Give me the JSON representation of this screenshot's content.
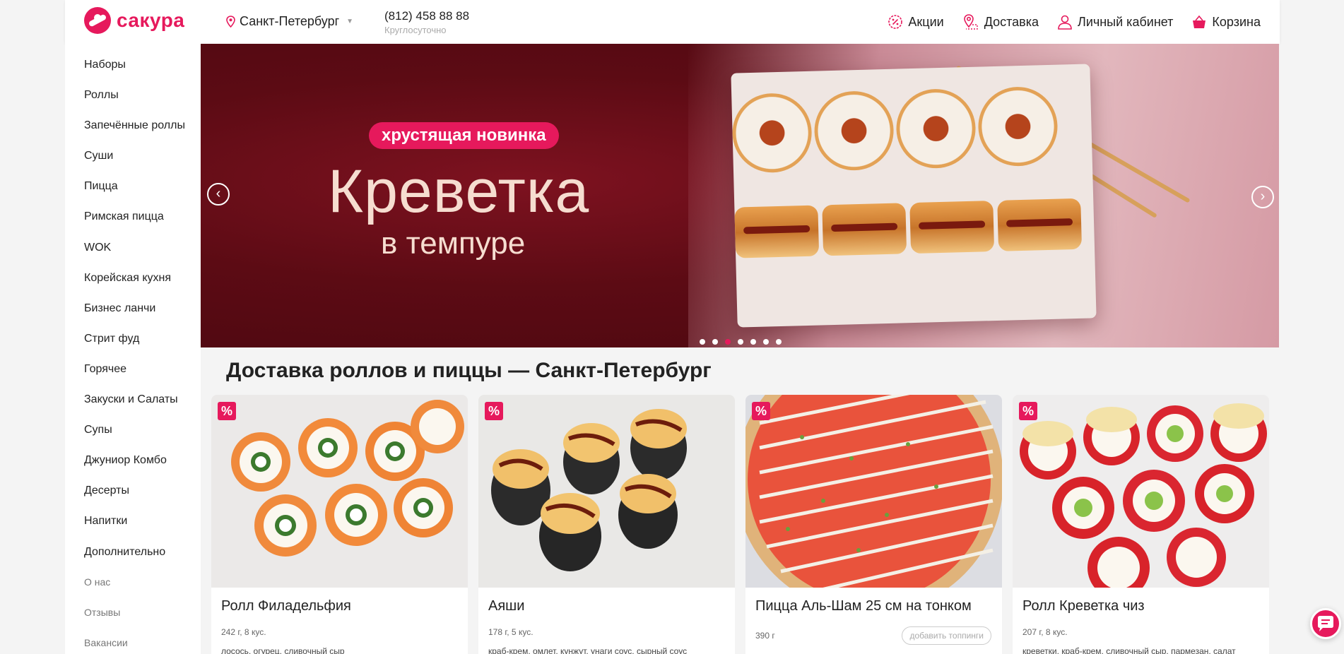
{
  "header": {
    "logo_text": "сакура",
    "city": "Санкт-Петербург",
    "phone": "(812) 458 88 88",
    "phone_hours": "Круглосуточно",
    "nav": [
      {
        "label": "Акции",
        "icon": "percent-badge-icon"
      },
      {
        "label": "Доставка",
        "icon": "map-pin-icon"
      },
      {
        "label": "Личный кабинет",
        "icon": "user-icon"
      },
      {
        "label": "Корзина",
        "icon": "basket-icon"
      }
    ]
  },
  "sidebar": {
    "items": [
      {
        "label": "Наборы"
      },
      {
        "label": "Роллы"
      },
      {
        "label": "Запечённые роллы"
      },
      {
        "label": "Суши"
      },
      {
        "label": "Пицца"
      },
      {
        "label": "Римская пицца"
      },
      {
        "label": "WOK"
      },
      {
        "label": "Корейская кухня"
      },
      {
        "label": "Бизнес ланчи"
      },
      {
        "label": "Стрит фуд"
      },
      {
        "label": "Горячее"
      },
      {
        "label": "Закуски и Салаты"
      },
      {
        "label": "Супы"
      },
      {
        "label": "Джуниор Комбо"
      },
      {
        "label": "Десерты"
      },
      {
        "label": "Напитки"
      },
      {
        "label": "Дополнительно"
      }
    ],
    "info_links": [
      {
        "label": "О нас"
      },
      {
        "label": "Отзывы"
      },
      {
        "label": "Вакансии"
      }
    ]
  },
  "banner": {
    "pill": "хрустящая новинка",
    "title": "Креветка",
    "subtitle": "в темпуре",
    "slide_count": 7,
    "active_slide": 3
  },
  "main": {
    "title": "Доставка роллов и пиццы — Санкт-Петербург"
  },
  "products": [
    {
      "name": "Ролл Филадельфия",
      "meta": "242 г, 8 кус.",
      "desc": "лосось, огурец, сливочный сыр",
      "badge": "%"
    },
    {
      "name": "Аяши",
      "meta": "178 г, 5 кус.",
      "desc": "краб-крем, омлет, кунжут, унаги соус, сырный соус",
      "badge": "%"
    },
    {
      "name": "Пицца Аль-Шам 25 см на тонком",
      "meta": "390 г",
      "desc": "",
      "button": "добавить топпинги",
      "badge": "%"
    },
    {
      "name": "Ролл Креветка чиз",
      "meta": "207 г, 8 кус.",
      "desc": "креветки, краб-крем, сливочный сыр, пармезан, салат",
      "badge": "%"
    }
  ],
  "colors": {
    "accent": "#e6195c",
    "banner_dark": "#5c0b14"
  }
}
